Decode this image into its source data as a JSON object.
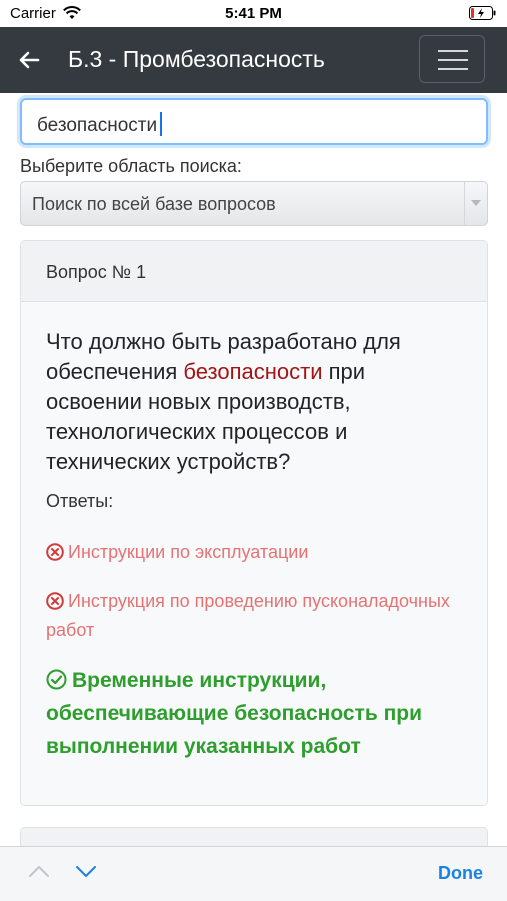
{
  "status_bar": {
    "carrier": "Carrier",
    "time": "5:41 PM",
    "wifi_icon": "wifi-icon",
    "battery_icon": "battery-charging-icon"
  },
  "navbar": {
    "back_icon": "arrow-left-icon",
    "title": "Б.3 - Промбезопасность",
    "menu_icon": "hamburger-menu-icon",
    "background": "#343a40"
  },
  "search": {
    "value": "безопасности",
    "border_color": "#80bdff"
  },
  "filter": {
    "label": "Выберите область поиска:",
    "selected": "Поиск по всей базе вопросов"
  },
  "question_card": {
    "header": "Вопрос № 1",
    "question_before": "Что должно быть разработано для обеспечения ",
    "question_highlight": "безопасности",
    "question_after": " при освоении новых производств, технологических процессов и технических устройств?",
    "answers_label": "Ответы:",
    "answers": [
      {
        "text": "Инструкции по эксплуатации",
        "correct": false,
        "icon": "x-circle-icon"
      },
      {
        "text": "Инструкция по проведению пусконаладочных работ",
        "correct": false,
        "icon": "x-circle-icon"
      },
      {
        "text": "Временные инструкции, обеспечивающие безопасность при выполнении указанных работ",
        "correct": true,
        "icon": "check-circle-icon"
      }
    ],
    "colors": {
      "highlight": "#a31515",
      "wrong": "#e57373",
      "correct": "#2e9e2e"
    }
  },
  "keyboard_accessory": {
    "prev_icon": "chevron-up-icon",
    "next_icon": "chevron-down-icon",
    "done_label": "Done"
  }
}
